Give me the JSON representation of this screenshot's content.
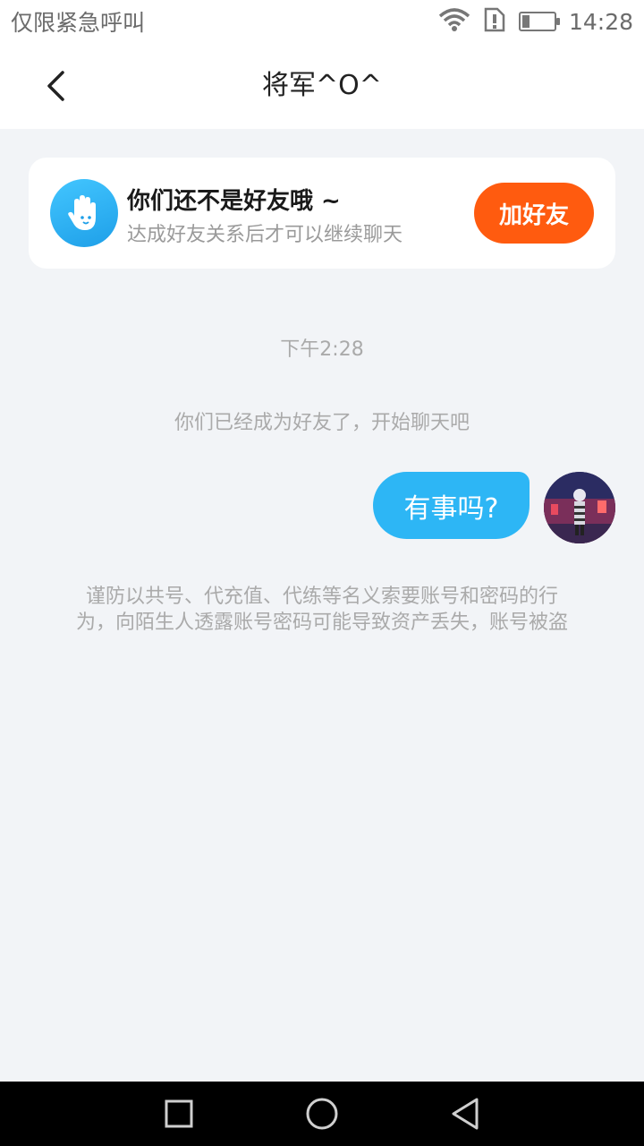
{
  "status_bar": {
    "left_text": "仅限紧急呼叫",
    "time": "14:28",
    "icons": [
      "wifi-icon",
      "sim-alert-icon",
      "battery-icon"
    ]
  },
  "header": {
    "title": "将军^O^",
    "back_icon": "chevron-left-icon"
  },
  "friend_banner": {
    "icon": "hand-wave-icon",
    "title": "你们还不是好友哦 ~",
    "subtitle": "达成好友关系后才可以继续聊天",
    "button_label": "加好友",
    "button_color": "#ff5b0f"
  },
  "chat": {
    "time_label": "下午2:28",
    "system_message": "你们已经成为好友了，开始聊天吧",
    "messages": [
      {
        "sender": "self",
        "text": "有事吗?"
      }
    ],
    "bubble_color": "#2db6f5",
    "warning_line1": "谨防以共号、代充值、代练等名义索要账号和密码的行",
    "warning_line2": "为，向陌生人透露账号密码可能导致资产丢失，账号被盗"
  },
  "nav_bar": {
    "buttons": [
      "recent-apps-icon",
      "home-icon",
      "back-triangle-icon"
    ]
  }
}
